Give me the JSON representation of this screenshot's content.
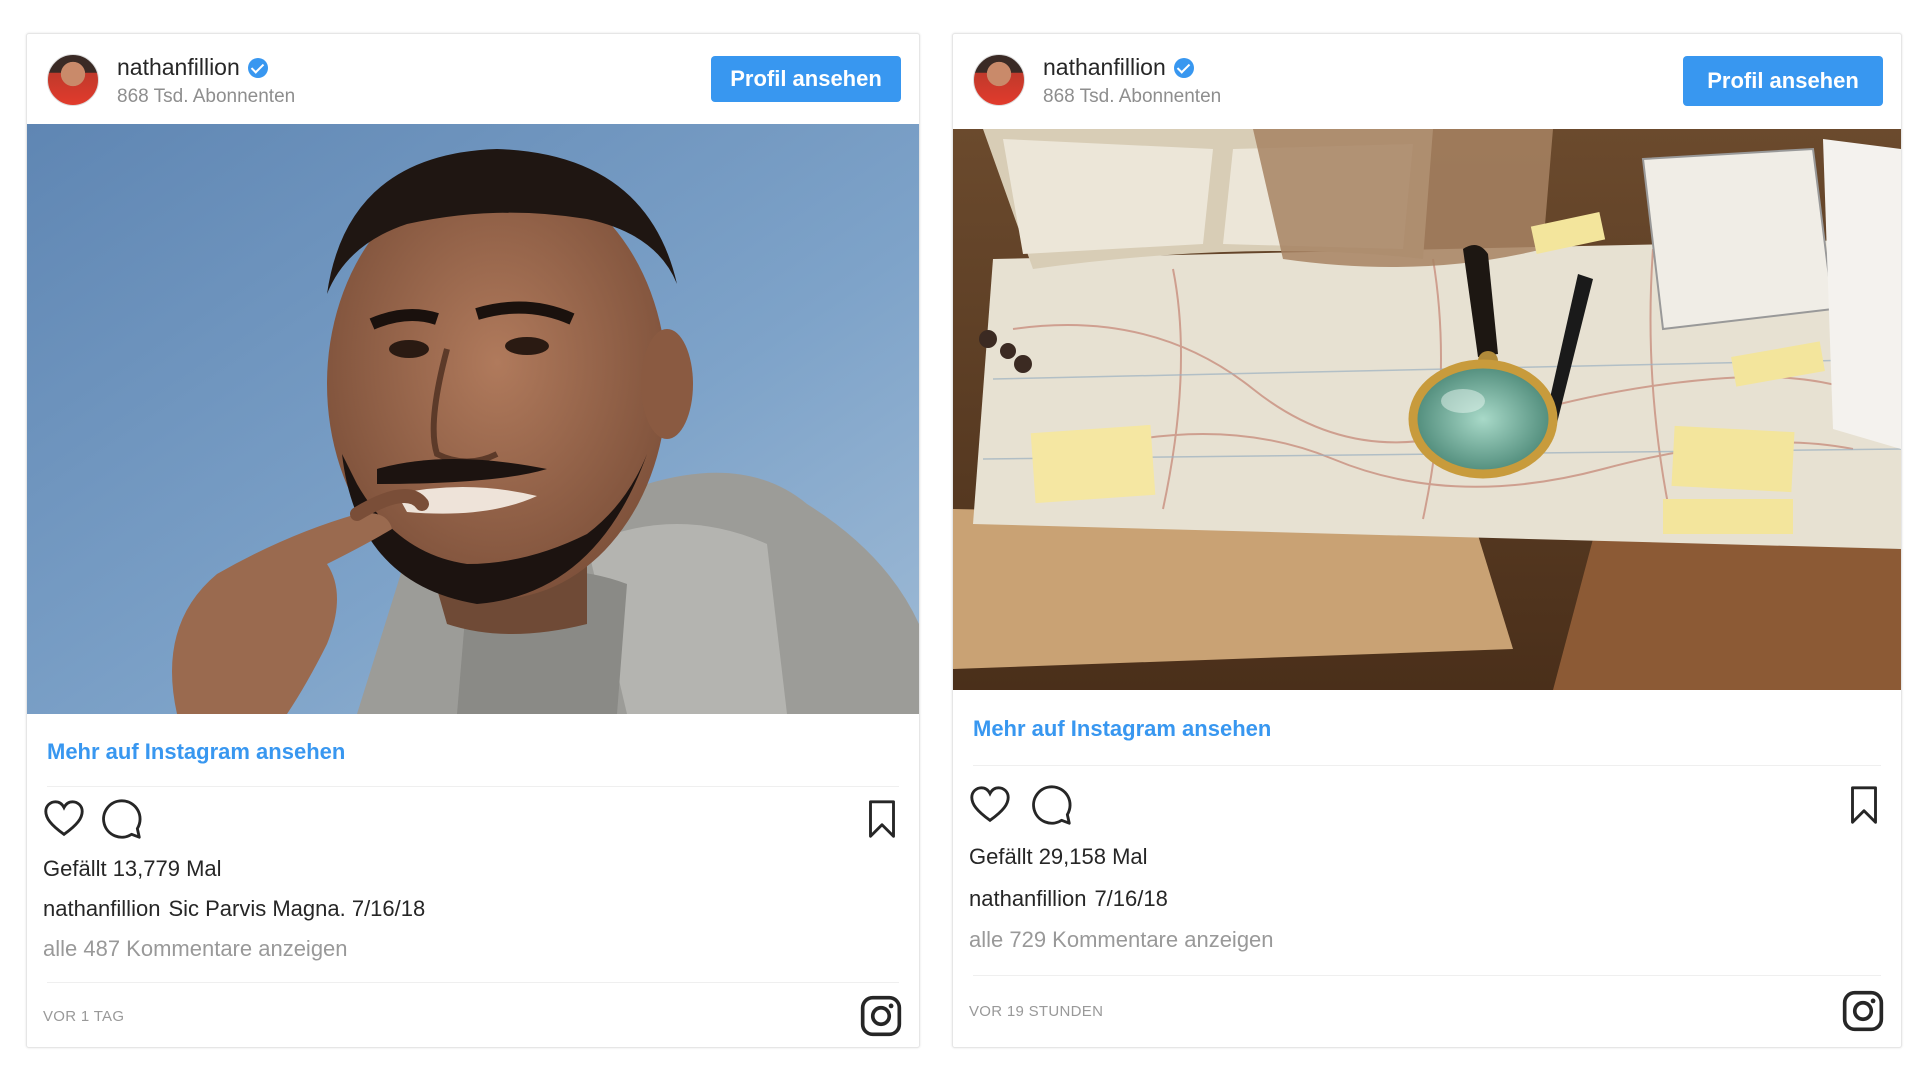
{
  "posts": [
    {
      "username": "nathanfillion",
      "subscribers": "868 Tsd. Abonnenten",
      "profile_button": "Profil ansehen",
      "photo_description_icon": "portrait-photo",
      "more_link": "Mehr auf Instagram ansehen",
      "likes": "Gefällt 13,779 Mal",
      "caption_user": "nathanfillion",
      "caption_text": "Sic Parvis Magna. 7/16/18",
      "comments": "alle 487 Kommentare anzeigen",
      "time": "VOR 1 TAG"
    },
    {
      "username": "nathanfillion",
      "subscribers": "868 Tsd. Abonnenten",
      "profile_button": "Profil ansehen",
      "photo_description_icon": "map-desk-photo",
      "more_link": "Mehr auf Instagram ansehen",
      "likes": "Gefällt 29,158 Mal",
      "caption_user": "nathanfillion",
      "caption_text": "7/16/18",
      "comments": "alle 729 Kommentare anzeigen",
      "time": "VOR 19 STUNDEN"
    }
  ],
  "colors": {
    "accent": "#3897f0",
    "text": "#262626",
    "muted": "#8e8e8e"
  },
  "icons": [
    "verified-badge-icon",
    "heart-icon",
    "comment-icon",
    "bookmark-icon",
    "instagram-logo-icon"
  ]
}
